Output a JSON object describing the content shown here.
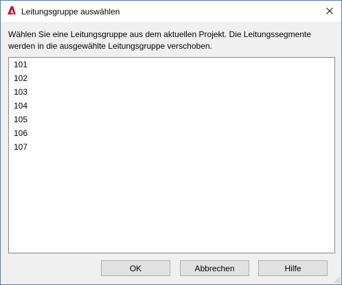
{
  "window": {
    "title": "Leitungsgruppe auswählen",
    "app_icon": "autocad-a-icon",
    "close_icon": "close-icon",
    "accent_color": "#c8102e",
    "border_color": "#4a7fb5"
  },
  "dialog": {
    "instruction": "Wählen Sie eine Leitungsgruppe aus dem aktuellen Projekt. Die Leitungssegmente werden in die ausgewählte Leitungsgruppe verschoben.",
    "list_items": [
      "101",
      "102",
      "103",
      "104",
      "105",
      "106",
      "107"
    ]
  },
  "buttons": {
    "ok_label": "OK",
    "cancel_label": "Abbrechen",
    "help_label": "Hilfe"
  }
}
